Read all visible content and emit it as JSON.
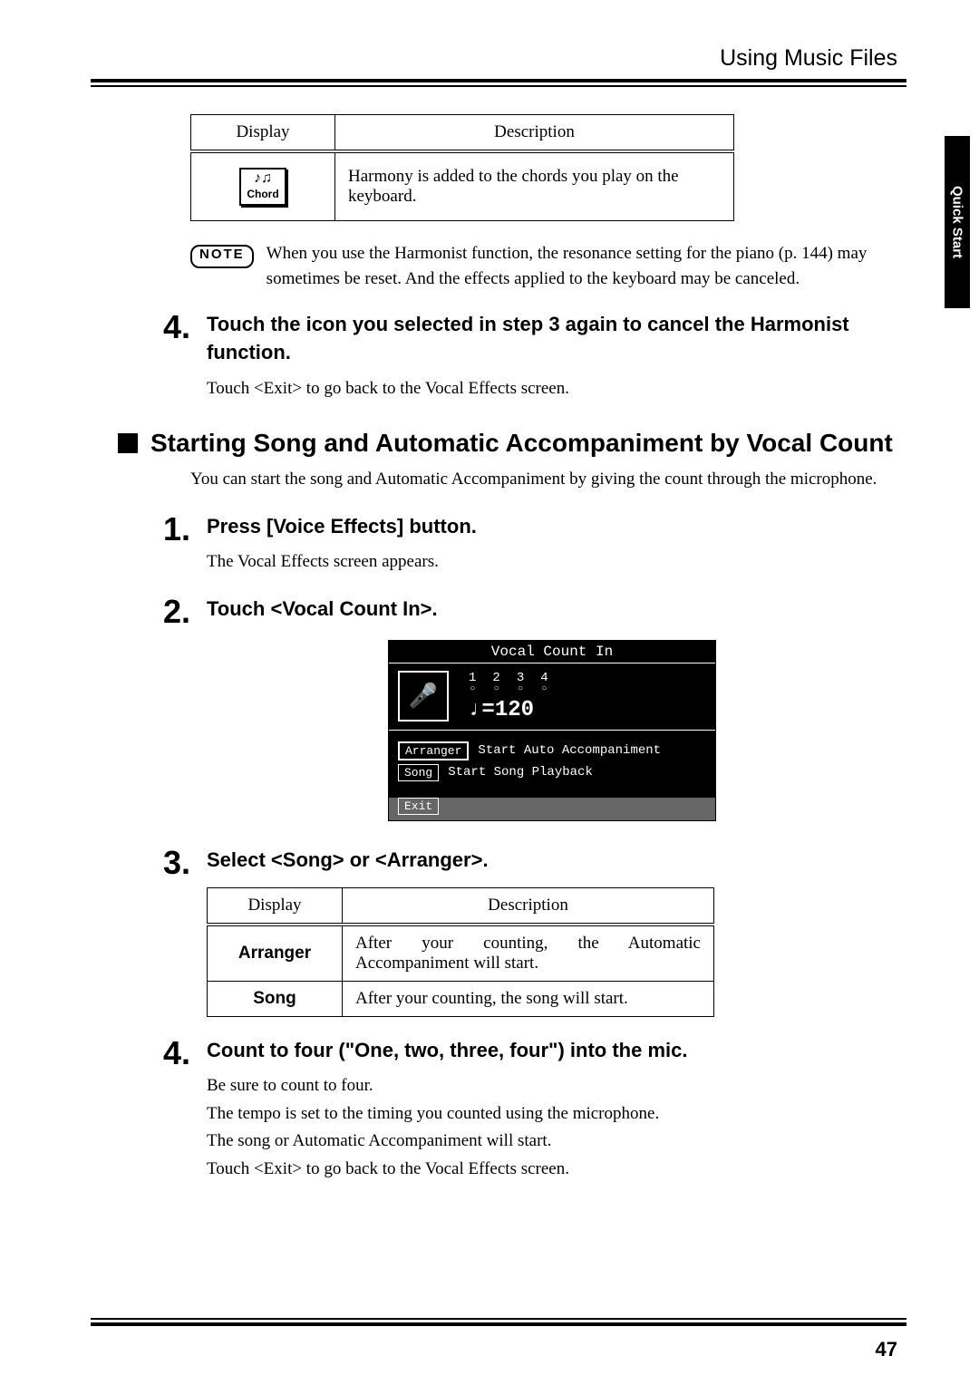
{
  "header": {
    "section_title": "Using Music Files"
  },
  "side_tab": {
    "label": "Quick Start"
  },
  "table1": {
    "headers": {
      "col1": "Display",
      "col2": "Description"
    },
    "row": {
      "chip_label": "Chord",
      "description": "Harmony is added to the chords you play on the keyboard."
    }
  },
  "note": {
    "badge": "NOTE",
    "text": "When you use the Harmonist function, the resonance setting for the piano (p. 144) may sometimes be reset. And the effects applied to the keyboard may be canceled."
  },
  "step4a": {
    "num": "4.",
    "title": "Touch the icon you selected in step 3 again to cancel the Harmonist function.",
    "text": "Touch <Exit> to go back to the Vocal Effects screen."
  },
  "section": {
    "title": "Starting Song and Automatic Accompaniment by Vocal Count",
    "intro": "You can start the song and Automatic Accompaniment by giving the count through the microphone."
  },
  "step1": {
    "num": "1.",
    "title": "Press [Voice Effects] button.",
    "text": "The Vocal Effects screen appears."
  },
  "step2": {
    "num": "2.",
    "title": "Touch <Vocal Count In>."
  },
  "lcd": {
    "title": "Vocal Count In",
    "counts": [
      "1",
      "2",
      "3",
      "4"
    ],
    "tempo_label": "♩=",
    "tempo_value": "120",
    "opt1_button": "Arranger",
    "opt1_label": "Start Auto Accompaniment",
    "opt2_button": "Song",
    "opt2_label": "Start Song Playback",
    "exit": "Exit"
  },
  "step3": {
    "num": "3.",
    "title": "Select <Song> or <Arranger>."
  },
  "table2": {
    "headers": {
      "col1": "Display",
      "col2": "Description"
    },
    "row1": {
      "label": "Arranger",
      "desc": "After your counting, the Automatic Accompaniment will start."
    },
    "row2": {
      "label": "Song",
      "desc": "After your counting, the song will start."
    }
  },
  "step4b": {
    "num": "4.",
    "title": "Count to four (\"One, two, three, four\") into the mic.",
    "line1": "Be sure to count to four.",
    "line2": "The tempo is set to the timing you counted using the microphone.",
    "line3": "The song or Automatic Accompaniment will start.",
    "line4": "Touch <Exit> to go back to the Vocal Effects screen."
  },
  "page_number": "47"
}
